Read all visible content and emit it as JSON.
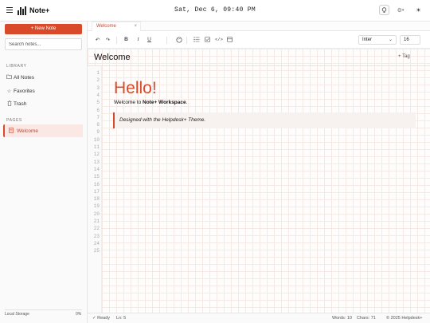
{
  "app": {
    "name": "Note+",
    "clock": "Sat, Dec 6, 09:40 PM"
  },
  "icons": {
    "menu": "hamburger-icon",
    "logo": "bars-logo-icon",
    "bulb": "lightbulb-icon",
    "settings": "gear-icon",
    "theme": "sun-icon",
    "brand_color": "#d84a2a"
  },
  "sidebar": {
    "new_note": "+ New Note",
    "search_placeholder": "Search notes...",
    "library_label": "LIBRARY",
    "library": [
      {
        "label": "All Notes",
        "icon": "folder-icon"
      },
      {
        "label": "Favorites",
        "icon": "star-icon"
      },
      {
        "label": "Trash",
        "icon": "trash-icon"
      }
    ],
    "pages_label": "PAGES",
    "pages": [
      {
        "label": "Welcome",
        "icon": "document-icon",
        "active": true
      }
    ],
    "storage_label": "Local Storage",
    "storage_pct": "0%",
    "storage_fraction": 0
  },
  "tabs": [
    {
      "label": "Welcome",
      "close": "×"
    }
  ],
  "toolbar": {
    "font": "Inter",
    "size": "16",
    "bold": "B",
    "italic": "I",
    "underline": "U"
  },
  "document": {
    "title": "Welcome",
    "tag_button": "+ Tag",
    "line_numbers": [
      "1",
      "2",
      "3",
      "4",
      "5",
      "6",
      "7",
      "8",
      "9",
      "10",
      "11",
      "12",
      "13",
      "14",
      "15",
      "16",
      "17",
      "18",
      "19",
      "20",
      "21",
      "22",
      "23",
      "24",
      "25"
    ],
    "heading": "Hello!",
    "welcome_prefix": "Welcome to ",
    "welcome_bold": "Note+ Workspace",
    "welcome_suffix": ".",
    "quote": "Designed with the Helpdesk+ Theme."
  },
  "status": {
    "ready": "✓ Ready",
    "line": "Ln: 5",
    "words": "Words: 10",
    "chars": "Chars: 71",
    "copyright": "© 2025 Helpdesk+"
  }
}
